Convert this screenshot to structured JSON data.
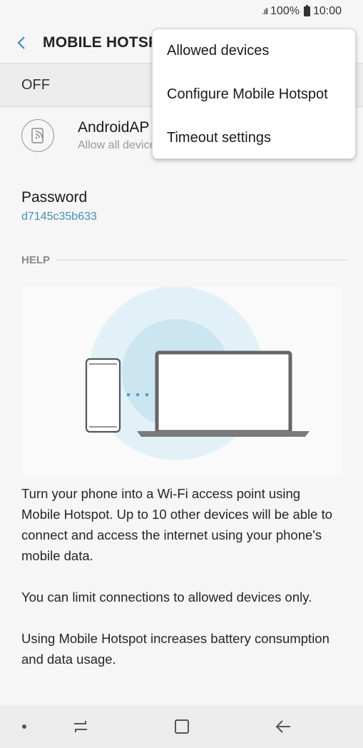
{
  "status_bar": {
    "signal": ".ıll",
    "battery": "100%",
    "time": "10:00"
  },
  "app_bar": {
    "title": "MOBILE HOTSPOT"
  },
  "switch": {
    "state": "OFF"
  },
  "access_point": {
    "name": "AndroidAP",
    "subtitle": "Allow all devices"
  },
  "password": {
    "label": "Password",
    "value": "d7145c35b633"
  },
  "help": {
    "header": "HELP",
    "paragraphs": [
      "Turn your phone into a Wi-Fi access point using Mobile Hotspot. Up to 10 other devices will be able to connect and access the internet using your phone's mobile data.",
      "You can limit connections to allowed devices only.",
      "Using Mobile Hotspot increases battery consumption and data usage."
    ]
  },
  "menu": {
    "items": [
      "Allowed devices",
      "Configure Mobile Hotspot",
      "Timeout settings"
    ]
  },
  "colors": {
    "accent": "#3f8fb6",
    "illustration_circle": "#d6ebf4"
  },
  "nav": {
    "icons": [
      "dot-icon",
      "recents-icon",
      "home-icon",
      "back-icon"
    ]
  }
}
